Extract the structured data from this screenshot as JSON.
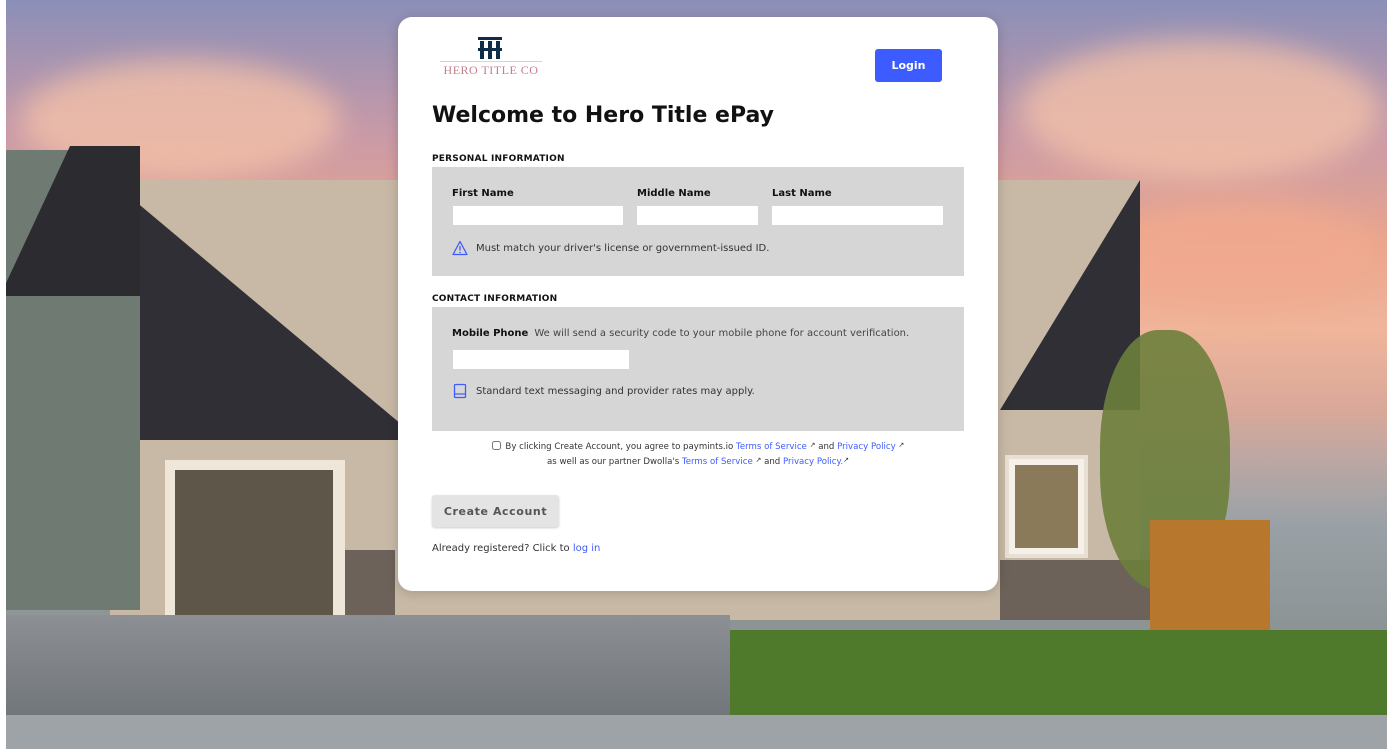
{
  "brand": {
    "wordmark": "HERO TITLE CO",
    "accent_color": "#3d5cff"
  },
  "header": {
    "login_label": "Login"
  },
  "title": "Welcome to Hero Title ePay",
  "personal": {
    "section_label": "PERSONAL INFORMATION",
    "first_name_label": "First Name",
    "middle_name_label": "Middle Name",
    "last_name_label": "Last Name",
    "first_name_value": "",
    "middle_name_value": "",
    "last_name_value": "",
    "id_hint": "Must match your driver's license or government-issued ID.",
    "id_hint_icon": "warning-icon"
  },
  "contact": {
    "section_label": "CONTACT INFORMATION",
    "mobile_label": "Mobile Phone",
    "mobile_note": "We will send a security code to your mobile phone for account verification.",
    "mobile_value": "",
    "rates_hint": "Standard text messaging and provider rates may apply.",
    "rates_hint_icon": "mobile-phone-icon"
  },
  "agreement": {
    "text_1": "By clicking Create Account, you agree to paymints.io",
    "tos_link_1": "Terms of Service",
    "and_1": "and",
    "privacy_link_1": "Privacy Policy",
    "text_2": "as well as our partner Dwolla's",
    "tos_link_2": "Terms of Service",
    "and_2": "and",
    "privacy_link_2": "Privacy Policy.",
    "external_icon": "external-link-icon",
    "checked": false
  },
  "create_account_label": "Create Account",
  "already": {
    "text": "Already registered? Click to",
    "link": "log in"
  }
}
